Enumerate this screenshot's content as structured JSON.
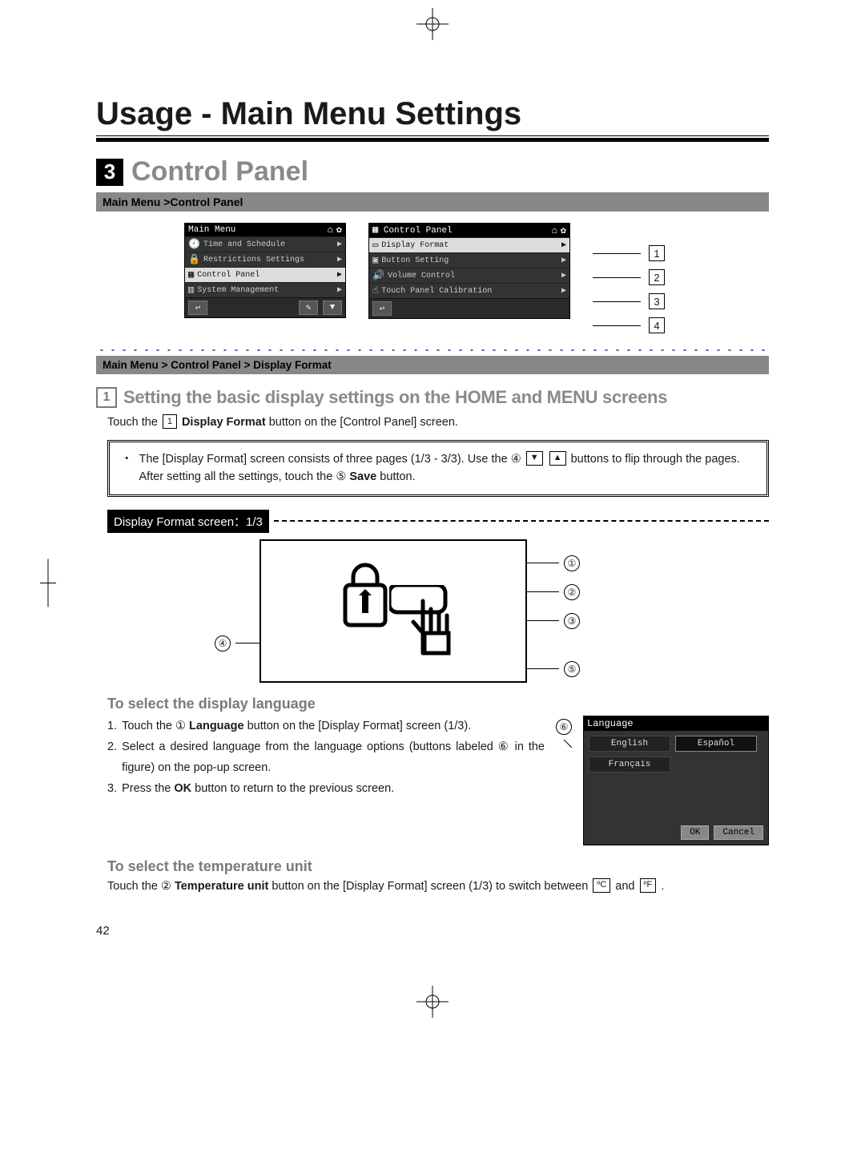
{
  "page": {
    "chapter_title": "Usage - Main Menu Settings",
    "section_number": "3",
    "section_title": "Control Panel",
    "page_number": "42"
  },
  "breadcrumb1": "Main Menu >Control Panel",
  "main_menu_screen": {
    "title": "Main Menu",
    "items": [
      "Time and Schedule",
      "Restrictions Settings",
      "Control Panel",
      "System Management"
    ],
    "selected_index": 2
  },
  "control_panel_screen": {
    "title": "Control Panel",
    "items": [
      {
        "label": "Display Format",
        "callout": "1"
      },
      {
        "label": "Button Setting",
        "callout": "2"
      },
      {
        "label": "Volume Control",
        "callout": "3"
      },
      {
        "label": "Touch Panel Calibration",
        "callout": "4"
      }
    ],
    "selected_index": 0
  },
  "breadcrumb2": "Main Menu > Control Panel > Display Format",
  "sub1": {
    "num": "1",
    "title": "Setting the basic display settings on the HOME and MENU screens",
    "intro_pre": "Touch the",
    "intro_box": "1",
    "intro_bold": "Display Format",
    "intro_post": "button on the [Control Panel] screen."
  },
  "note": {
    "line1a": "The [Display Format] screen consists of three pages (1/3 - 3/3). Use the",
    "c4": "④",
    "line1b": "buttons to flip through the pages. After setting all the settings, touch the",
    "c5": "⑤",
    "save": "Save",
    "line1c": "button."
  },
  "screen_label": "Display Format screen：1/3",
  "diagram": {
    "right": [
      "①",
      "②",
      "③",
      "⑤"
    ],
    "left": [
      "④"
    ]
  },
  "lang_section": {
    "heading": "To select the display language",
    "step1_pre": "Touch the",
    "step1_c": "①",
    "step1_bold": "Language",
    "step1_post": "button on the [Display Format] screen (1/3).",
    "callout6": "⑥",
    "step2_pre": "Select a desired language from the language options (buttons labeled",
    "step2_c": "⑥",
    "step2_post": "in the figure) on the pop-up screen.",
    "step3_pre": "Press the",
    "step3_bold": "OK",
    "step3_post": "button to return to the previous screen."
  },
  "lang_panel": {
    "title": "Language",
    "options": [
      "English",
      "Español",
      "Français"
    ],
    "selected_index": 1,
    "ok": "OK",
    "cancel": "Cancel"
  },
  "temp_section": {
    "heading": "To select the temperature unit",
    "pre": "Touch the",
    "c": "②",
    "bold": "Temperature unit",
    "mid": "button on the [Display Format] screen (1/3) to switch between",
    "c_unit": "ºC",
    "and": "and",
    "f_unit": "ºF",
    "end": "."
  }
}
